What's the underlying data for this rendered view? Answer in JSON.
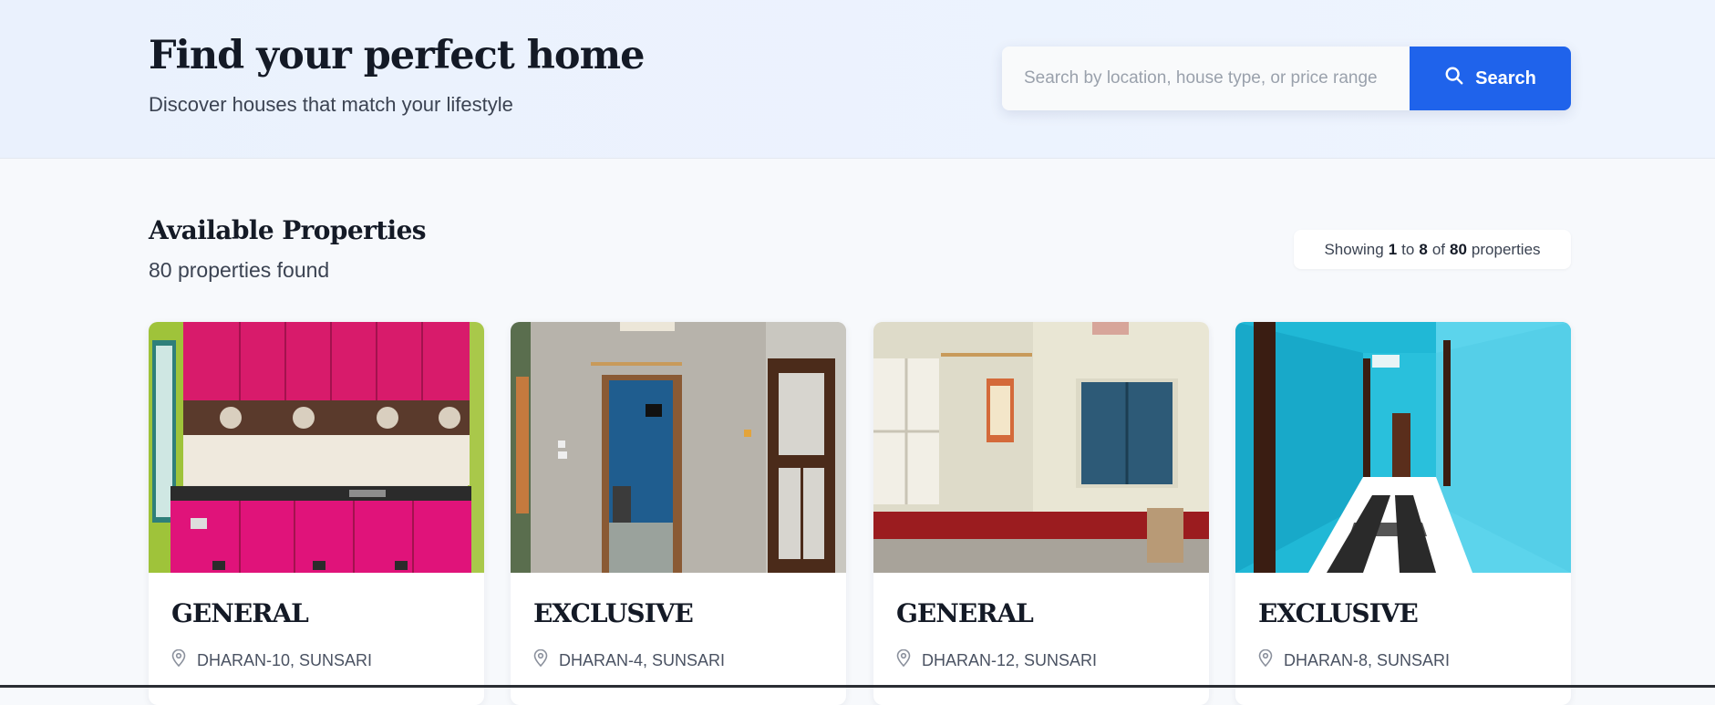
{
  "hero": {
    "title": "Find your perfect home",
    "subtitle": "Discover houses that match your lifestyle"
  },
  "search": {
    "placeholder": "Search by location, house type, or price range",
    "button_label": "Search",
    "button_icon": "search-icon",
    "accent_color": "#1f63eb"
  },
  "listing": {
    "title": "Available Properties",
    "count_text": "80 properties found",
    "showing": {
      "prefix": "Showing",
      "from": "1",
      "to_word": "to",
      "to": "8",
      "of_word": "of",
      "total": "80",
      "suffix": "properties"
    }
  },
  "cards": [
    {
      "type": "GENERAL",
      "location": "DHARAN-10, SUNSARI",
      "photo": "pink kitchen cabinets"
    },
    {
      "type": "EXCLUSIVE",
      "location": "DHARAN-4, SUNSARI",
      "photo": "grey room with open doorway"
    },
    {
      "type": "GENERAL",
      "location": "DHARAN-12, SUNSARI",
      "photo": "cream room with blue window shutters"
    },
    {
      "type": "EXCLUSIVE",
      "location": "DHARAN-8, SUNSARI",
      "photo": "turquoise hallway with checkered floor"
    }
  ]
}
